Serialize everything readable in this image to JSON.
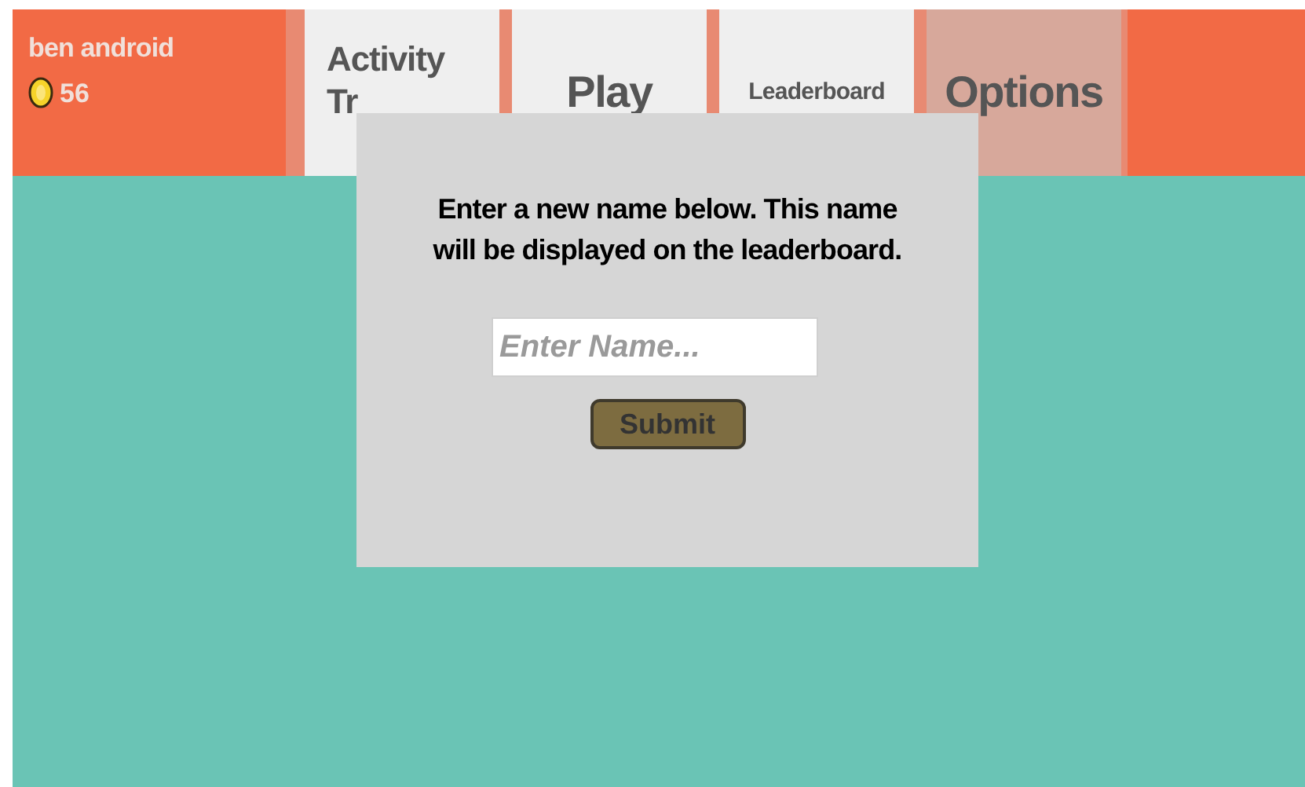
{
  "user": {
    "name": "ben android",
    "coins": "56"
  },
  "tabs": [
    {
      "label": "Activity Tr",
      "selected": false
    },
    {
      "label": "Play",
      "selected": false
    },
    {
      "label": "Leaderboard",
      "selected": false
    },
    {
      "label": "Options",
      "selected": true
    }
  ],
  "dialog": {
    "message": "Enter a new name below. This name will be displayed on the leaderboard.",
    "name_field": {
      "placeholder": "Enter Name..."
    },
    "submit_button": "Submit"
  }
}
